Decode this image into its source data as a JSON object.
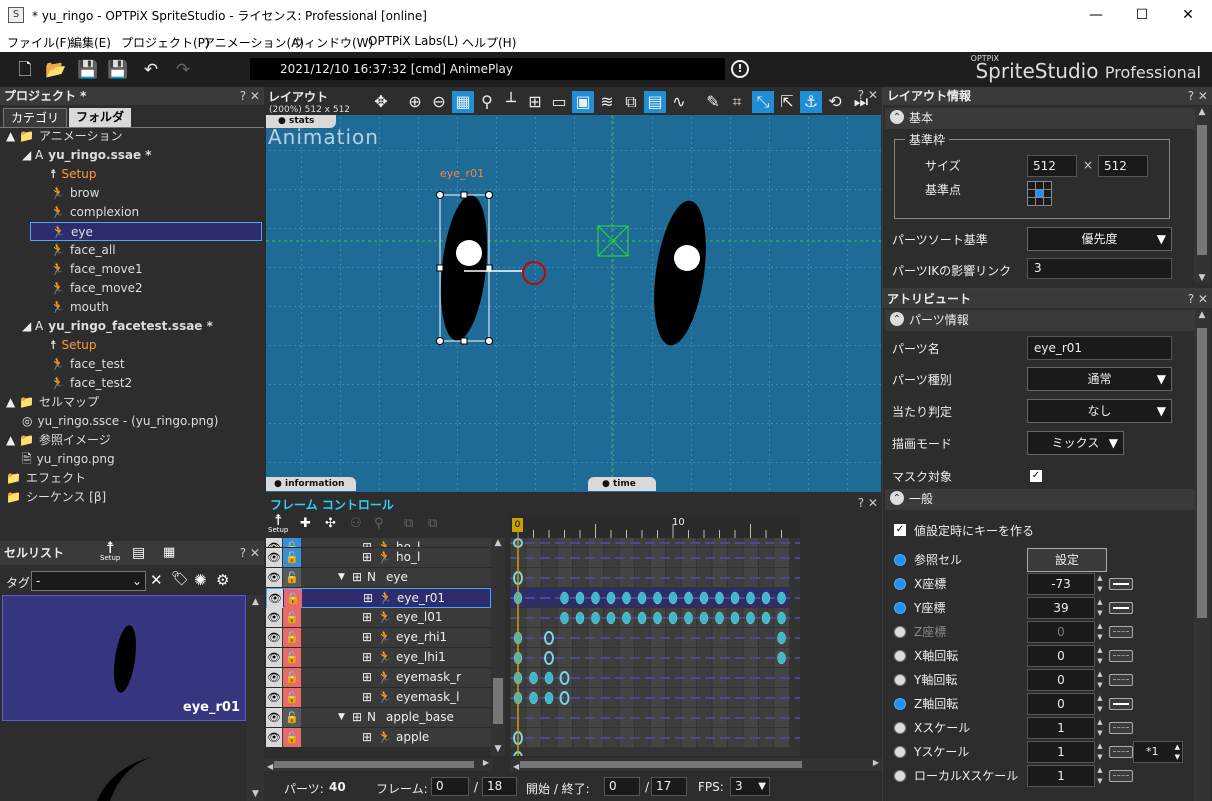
{
  "window": {
    "title": "* yu_ringo - OPTPiX SpriteStudio - ライセンス: Professional [online]",
    "app_icon": "S",
    "minimize": "—",
    "maximize": "☐",
    "close": "✕"
  },
  "menu": [
    "ファイル(F)",
    "編集(E)",
    "プロジェクト(P)",
    "アニメーション(A)",
    "ウィンドウ(W)",
    "OPTPiX Labs(L)",
    "ヘルプ(H)"
  ],
  "status": "2021/12/10 16:37:32   [cmd] AnimePlay",
  "logo": {
    "brand": "OPTPiX",
    "product": "SpriteStudio",
    "edition": "Professional"
  },
  "project": {
    "title": "プロジェクト *",
    "controls": "? ✕",
    "tabs": [
      "カテゴリ",
      "フォルダ"
    ],
    "tree": [
      {
        "label": "アニメーション",
        "icon": "▲ 📁",
        "indent": 0
      },
      {
        "label": "yu_ringo.ssae *",
        "icon": "◢ A",
        "indent": 1,
        "bold": true
      },
      {
        "label": "Setup",
        "icon": "☨",
        "indent": 2,
        "orange": true
      },
      {
        "label": "brow",
        "icon": "🏃",
        "indent": 2
      },
      {
        "label": "complexion",
        "icon": "🏃",
        "indent": 2
      },
      {
        "label": "eye",
        "icon": "🏃",
        "indent": 2,
        "selected": true
      },
      {
        "label": "face_all",
        "icon": "🏃",
        "indent": 2
      },
      {
        "label": "face_move1",
        "icon": "🏃",
        "indent": 2
      },
      {
        "label": "face_move2",
        "icon": "🏃",
        "indent": 2
      },
      {
        "label": "mouth",
        "icon": "🏃",
        "indent": 2
      },
      {
        "label": "yu_ringo_facetest.ssae *",
        "icon": "◢ A",
        "indent": 1,
        "bold": true
      },
      {
        "label": "Setup",
        "icon": "☨",
        "indent": 2,
        "orange": true
      },
      {
        "label": "face_test",
        "icon": "🏃",
        "indent": 2
      },
      {
        "label": "face_test2",
        "icon": "🏃",
        "indent": 2
      },
      {
        "label": "セルマップ",
        "icon": "▲ 📁",
        "indent": 0
      },
      {
        "label": "yu_ringo.ssce - (yu_ringo.png)",
        "icon": "◎",
        "indent": 1
      },
      {
        "label": "参照イメージ",
        "icon": "▲ 📁",
        "indent": 0
      },
      {
        "label": "yu_ringo.png",
        "icon": "🖹",
        "indent": 1
      },
      {
        "label": "エフェクト",
        "icon": "📁",
        "indent": 0
      },
      {
        "label": "シーケンス [β]",
        "icon": "📁",
        "indent": 0
      }
    ]
  },
  "cell_list": {
    "title": "セルリスト",
    "controls": "? ✕",
    "tag_label": "タグ",
    "tag_value": "-",
    "setup_label": "Setup",
    "cell_name": "eye_r01"
  },
  "layout": {
    "title": "レイアウト",
    "size_info": "(200%) 512 x 512",
    "controls": "? ✕",
    "stats_tab": "● stats",
    "anim_label": "Animation",
    "selected_part": "eye_r01",
    "information_tab": "● information",
    "time_tab": "● time"
  },
  "frame_control": {
    "title": "フレーム コントロール",
    "controls": "? ✕",
    "setup_label": "Setup",
    "ruler_start": "0",
    "ruler_ten": "10",
    "rows": [
      {
        "name": "ho_l",
        "indent": 2,
        "type": "part",
        "cut": true
      },
      {
        "name": "ho_l",
        "indent": 2,
        "type": "part"
      },
      {
        "name": "eye",
        "indent": 1,
        "type": "null",
        "expand": true
      },
      {
        "name": "eye_r01",
        "indent": 2,
        "type": "part",
        "selected": true
      },
      {
        "name": "eye_l01",
        "indent": 2,
        "type": "part"
      },
      {
        "name": "eye_rhi1",
        "indent": 2,
        "type": "part"
      },
      {
        "name": "eye_lhi1",
        "indent": 2,
        "type": "part"
      },
      {
        "name": "eyemask_r",
        "indent": 2,
        "type": "part"
      },
      {
        "name": "eyemask_l",
        "indent": 2,
        "type": "part"
      },
      {
        "name": "apple_base",
        "indent": 1,
        "type": "null",
        "expand": true
      },
      {
        "name": "apple",
        "indent": 2,
        "type": "part"
      }
    ],
    "parts_label": "パーツ:",
    "parts_count": "40",
    "frame_label": "フレーム:",
    "frame_current": "0",
    "frame_total": "18",
    "range_label": "開始 / 終了:",
    "range_start": "0",
    "range_end": "17",
    "fps_label": "FPS:",
    "fps_value": "3"
  },
  "layout_info": {
    "title": "レイアウト情報",
    "controls": "? ✕",
    "section_basic": "基本",
    "group_label": "基準枠",
    "size_label": "サイズ",
    "width": "512",
    "times": "×",
    "height": "512",
    "origin_label": "基準点",
    "sort_label": "パーツソート基準",
    "sort_value": "優先度",
    "ik_label": "パーツIKの影響リンク",
    "ik_value": "3"
  },
  "attribute": {
    "title": "アトリビュート",
    "controls": "? ✕",
    "section_part": "パーツ情報",
    "part_name_label": "パーツ名",
    "part_name": "eye_r01",
    "part_type_label": "パーツ種別",
    "part_type": "通常",
    "hit_label": "当たり判定",
    "hit_value": "なし",
    "draw_label": "描画モード",
    "draw_value": "ミックス",
    "mask_label": "マスク対象",
    "section_general": "一般",
    "auto_key_label": "値設定時にキーを作る",
    "ref_cell_label": "参照セル",
    "ref_cell_button": "設定",
    "fields": [
      {
        "label": "X座標",
        "value": "-73",
        "on": true,
        "link": true
      },
      {
        "label": "Y座標",
        "value": "39",
        "on": true,
        "link": true
      },
      {
        "label": "Z座標",
        "value": "0",
        "on": false,
        "link": false,
        "dim": true
      },
      {
        "label": "X軸回転",
        "value": "0",
        "on": false,
        "link": false
      },
      {
        "label": "Y軸回転",
        "value": "0",
        "on": false,
        "link": false
      },
      {
        "label": "Z軸回転",
        "value": "0",
        "on": true,
        "link": true
      },
      {
        "label": "Xスケール",
        "value": "1",
        "on": false,
        "link": false
      },
      {
        "label": "Yスケール",
        "value": "1",
        "on": false,
        "link": false
      },
      {
        "label": "ローカルXスケール",
        "value": "1",
        "on": false,
        "link": false
      }
    ],
    "yscale_mult": "*1"
  }
}
